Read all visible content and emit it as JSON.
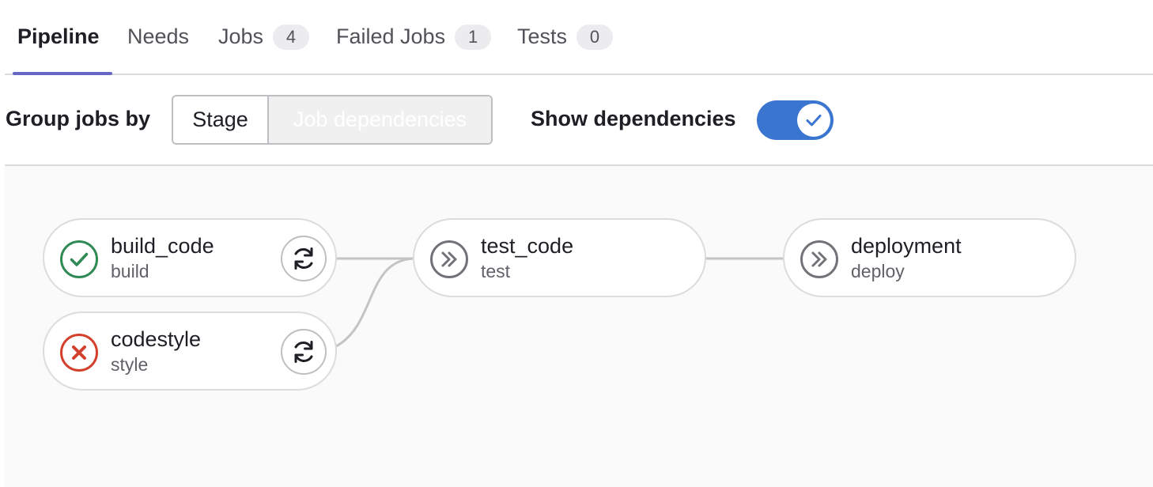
{
  "tabs": [
    {
      "label": "Pipeline",
      "active": true
    },
    {
      "label": "Needs"
    },
    {
      "label": "Jobs",
      "count": "4"
    },
    {
      "label": "Failed Jobs",
      "count": "1"
    },
    {
      "label": "Tests",
      "count": "0"
    }
  ],
  "controls": {
    "group_label": "Group jobs by",
    "stage_option": "Stage",
    "job_dependencies_option": "Job dependencies",
    "selected_option": "Job dependencies",
    "show_dependencies_label": "Show dependencies",
    "show_dependencies_on": true
  },
  "jobs": [
    {
      "name": "build_code",
      "stage": "build",
      "status": "success",
      "status_icon": "check-circle-icon",
      "action": "retry",
      "action_icon": "retry-icon"
    },
    {
      "name": "codestyle",
      "stage": "style",
      "status": "failed",
      "status_icon": "x-circle-icon",
      "action": "retry",
      "action_icon": "retry-icon"
    },
    {
      "name": "test_code",
      "stage": "test",
      "status": "skipped",
      "status_icon": "skipped-icon"
    },
    {
      "name": "deployment",
      "stage": "deploy",
      "status": "skipped",
      "status_icon": "skipped-icon"
    }
  ],
  "dependencies": [
    {
      "from": "build_code",
      "to": "test_code"
    },
    {
      "from": "codestyle",
      "to": "test_code"
    },
    {
      "from": "test_code",
      "to": "deployment"
    }
  ],
  "colors": {
    "accent_tab": "#6666c4",
    "toggle_on": "#3a75d0",
    "success": "#2f8a55",
    "failed": "#d2412c",
    "skipped": "#737278",
    "link": "#c4c4c4"
  }
}
